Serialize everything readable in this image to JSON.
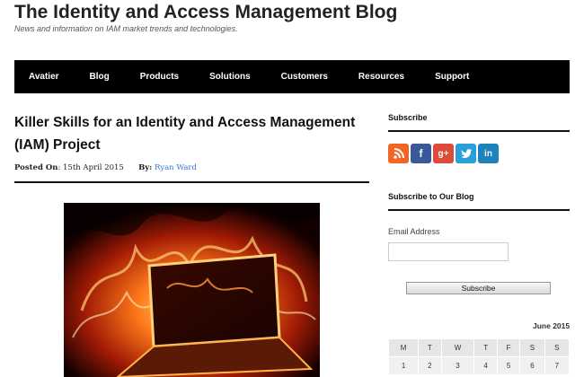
{
  "site": {
    "title": "The Identity and Access Management Blog",
    "tagline": "News and information on IAM market trends and technologies."
  },
  "nav": {
    "items": [
      {
        "label": "Avatier"
      },
      {
        "label": "Blog"
      },
      {
        "label": "Products"
      },
      {
        "label": "Solutions"
      },
      {
        "label": "Customers"
      },
      {
        "label": "Resources"
      },
      {
        "label": "Support"
      }
    ]
  },
  "post": {
    "title": "Killer Skills for an Identity and Access Management (IAM) Project",
    "posted_on_label": "Posted On",
    "posted_on_value": ": 15th April 2015",
    "by_label": "By:",
    "author": "Ryan Ward"
  },
  "sidebar": {
    "subscribe_heading": "Subscribe",
    "social_icons": [
      "rss-icon",
      "facebook-icon",
      "google-plus-icon",
      "twitter-icon",
      "linkedin-icon"
    ],
    "subscribe_blog_heading": "Subscribe to Our Blog",
    "email_label": "Email Address",
    "email_value": "",
    "subscribe_button": "Subscribe",
    "calendar": {
      "caption": "June 2015",
      "weekdays": [
        "M",
        "T",
        "W",
        "T",
        "F",
        "S",
        "S"
      ],
      "first_row": [
        "1",
        "2",
        "3",
        "4",
        "5",
        "6",
        "7"
      ]
    }
  },
  "colors": {
    "nav_bg": "#000000",
    "author_link": "#3a7bd5",
    "rss": "#f26522",
    "facebook": "#3b5998",
    "google_plus": "#dd4b39",
    "twitter": "#2a9fd8",
    "linkedin": "#1c82b9"
  }
}
